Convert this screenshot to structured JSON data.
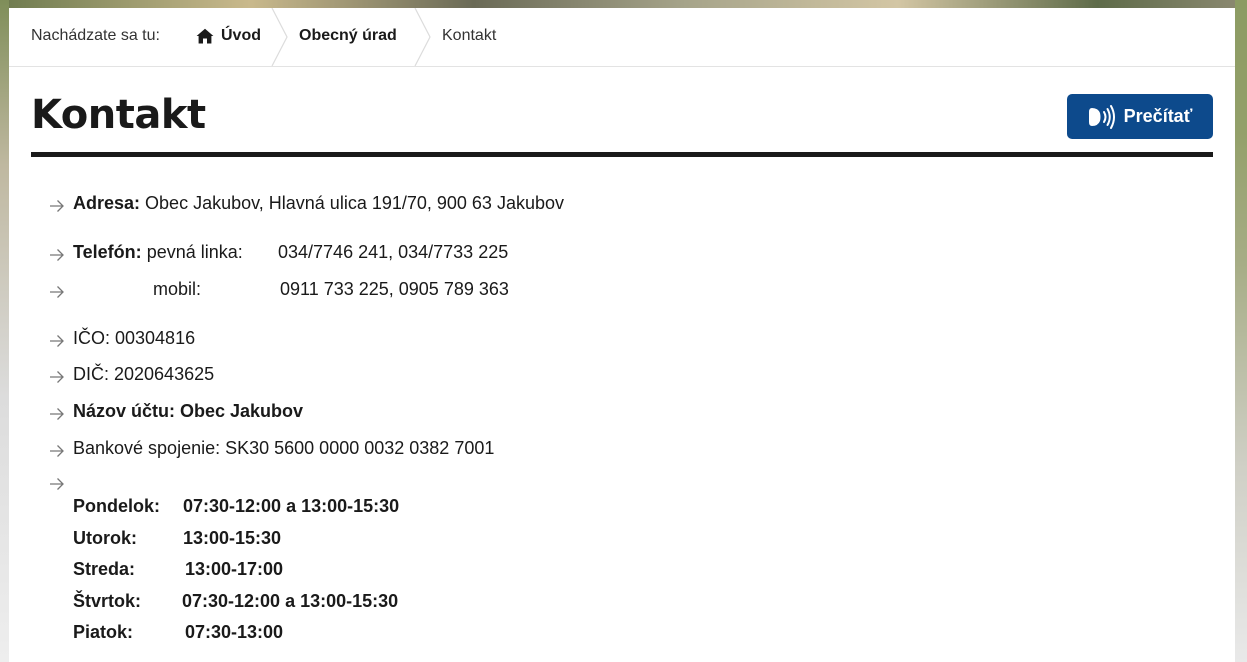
{
  "breadcrumb": {
    "prefix": "Nachádzate sa tu:",
    "home": "Úvod",
    "office": "Obecný úrad",
    "current": "Kontakt"
  },
  "page": {
    "title": "Kontakt",
    "read_button": "Prečítať"
  },
  "contact": {
    "address_label": "Adresa:",
    "address_value": "Obec Jakubov, Hlavná ulica 191/70, 900 63 Jakubov",
    "phone_label": "Telefón:",
    "phone_landline_label": "pevná linka:",
    "phone_landline_value": "034/7746 241, 034/7733 225",
    "phone_mobile_label": "mobil:",
    "phone_mobile_value": "0911 733 225, 0905 789 363",
    "ico": "IČO: 00304816",
    "dic": "DIČ: 2020643625",
    "account_name": "Názov účtu: Obec Jakubov",
    "bank": "Bankové spojenie: SK30 5600 0000 0032 0382 7001"
  },
  "office_hours": [
    {
      "day": "Pondelok:",
      "time": "07:30-12:00 a 13:00-15:30"
    },
    {
      "day": "Utorok:",
      "time": "13:00-15:30"
    },
    {
      "day": "Streda:",
      "time": "13:00-17:00"
    },
    {
      "day": "Štvrtok:",
      "time": "07:30-12:00 a 13:00-15:30"
    },
    {
      "day": "Piatok:",
      "time": "07:30-13:00"
    }
  ],
  "icons": {
    "home": "home-icon",
    "speaker": "speaker-icon",
    "arrow": "arrow-right-icon",
    "separator": "chevron-separator"
  },
  "colors": {
    "accent": "#0d4a8c",
    "text": "#1a1a1a"
  }
}
